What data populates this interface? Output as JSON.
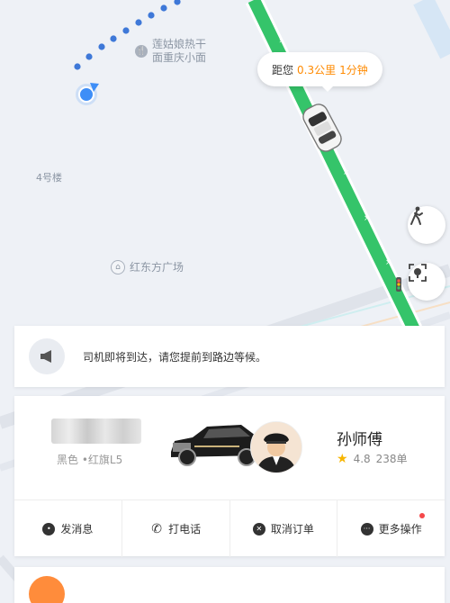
{
  "map": {
    "poi_noodle": {
      "line1": "莲姑娘热干",
      "line2": "面重庆小面"
    },
    "poi_building": "4号楼",
    "poi_plaza": "红东方广场"
  },
  "eta": {
    "prefix": "距您",
    "distance": "0.3公里",
    "time": "1分钟"
  },
  "notice": {
    "message": "司机即将到达，请您提前到路边等候。"
  },
  "driver": {
    "car_description": "黑色 •红旗L5",
    "name": "孙师傅",
    "rating": "4.8",
    "orders": "238单"
  },
  "actions": [
    {
      "label": "发消息",
      "icon": "chat-icon"
    },
    {
      "label": "打电话",
      "icon": "phone-icon"
    },
    {
      "label": "取消订单",
      "icon": "cancel-icon"
    },
    {
      "label": "更多操作",
      "icon": "more-icon"
    }
  ],
  "colors": {
    "accent": "#ff8a00",
    "route": "#35c46a",
    "badge": "#f5484a",
    "my_location": "#3e8ef7"
  }
}
